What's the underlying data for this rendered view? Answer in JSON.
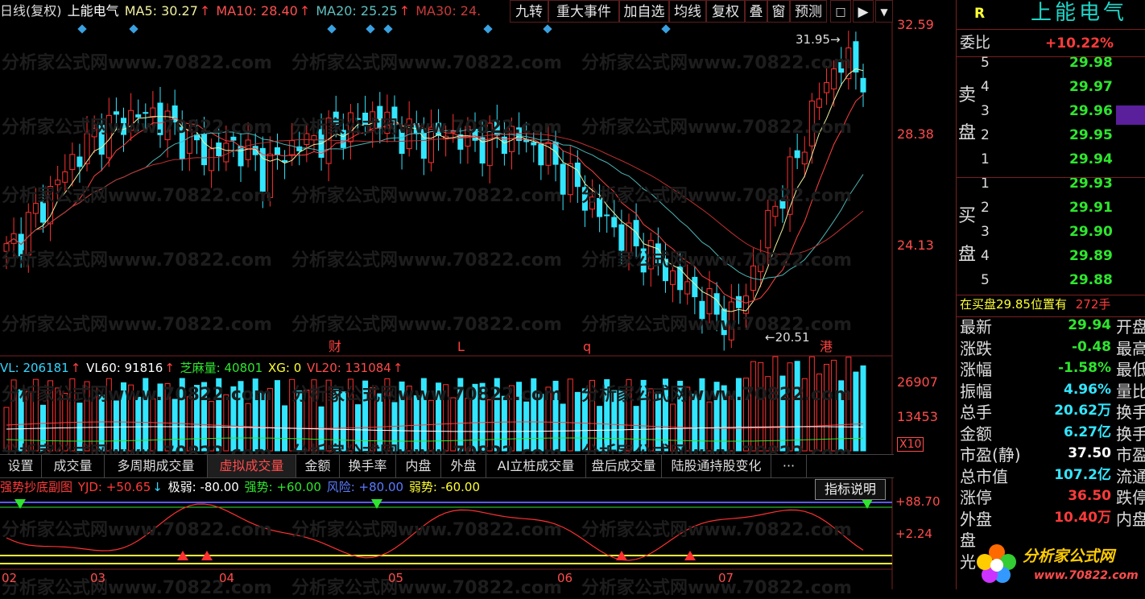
{
  "header": {
    "period": "日线(复权)",
    "stock_name": "上能电气",
    "ma5": "MA5: 30.27",
    "ma10": "MA10: 28.40",
    "ma20": "MA20: 25.25",
    "ma30": "MA30: 24.",
    "arrow": "↑"
  },
  "toolbar": {
    "btn_jiuzhuan": "九转",
    "btn_events": "重大事件",
    "btn_add": "加自选",
    "btn_ma": "均线",
    "btn_fuquan": "复权",
    "btn_die": "叠",
    "btn_chuang": "窗",
    "btn_yuce": "预测",
    "btn_lock": "🔒",
    "btn_jump": "⇥",
    "btn_menu": "▾"
  },
  "price_axis": {
    "top": "32.59",
    "mid": "28.38",
    "low": "24.13"
  },
  "annotations": {
    "high": "31.95",
    "low": "20.51",
    "marker_cai": "财",
    "marker_L": "L",
    "marker_q": "q",
    "marker_gang": "港"
  },
  "volume_legend": {
    "vl": "VL: 206181",
    "vl60": "VL60: 91816",
    "zhima": "芝麻量: 40801",
    "xg": "XG: 0",
    "vl20": "VL20: 131084",
    "arrow": "↑"
  },
  "volume_axis": {
    "top": "26907",
    "mid": "13453",
    "unit": "X10"
  },
  "tabs": [
    "设置",
    "成交量",
    "多周期成交量",
    "虚拟成交量",
    "金额",
    "换手率",
    "内盘",
    "外盘",
    "AI立桩成交量",
    "盘后成交量",
    "陆股通持股变化",
    "···"
  ],
  "active_tab": "虚拟成交量",
  "indicator_legend": {
    "name": "强势抄底副图",
    "yjd": "YJD: +50.65",
    "yjd_arrow": "↓",
    "jiruo": "极弱: -80.00",
    "qiangshi": "强势: +60.00",
    "fengxian": "风险: +80.00",
    "ruoshi": "弱势: -60.00",
    "help_button": "指标说明"
  },
  "indicator_axis": {
    "top": "+88.70",
    "mid": "+2.24"
  },
  "date_axis": [
    "02",
    "03",
    "04",
    "05",
    "06",
    "07"
  ],
  "watermark": "分析家公式网www.70822.com",
  "right_panel": {
    "r_label": "R",
    "title": "上能电气",
    "weibi_label": "委比",
    "weibi_value": "+10.22%",
    "sell_group_label_1": "卖",
    "sell_group_label_2": "盘",
    "buy_group_label_1": "买",
    "buy_group_label_2": "盘",
    "sell": [
      {
        "level": "5",
        "price": "29.98"
      },
      {
        "level": "4",
        "price": "29.97"
      },
      {
        "level": "3",
        "price": "29.96"
      },
      {
        "level": "2",
        "price": "29.95"
      },
      {
        "level": "1",
        "price": "29.94"
      }
    ],
    "buy": [
      {
        "level": "1",
        "price": "29.93"
      },
      {
        "level": "2",
        "price": "29.91"
      },
      {
        "level": "3",
        "price": "29.90"
      },
      {
        "level": "4",
        "price": "29.89"
      },
      {
        "level": "5",
        "price": "29.88"
      }
    ],
    "notice_text": "在买盘29.85位置有",
    "notice_qty": "272手",
    "quotes": [
      {
        "label": "最新",
        "value": "29.94",
        "color": "green",
        "side": "开盘"
      },
      {
        "label": "涨跌",
        "value": "-0.48",
        "color": "green",
        "side": "最高"
      },
      {
        "label": "涨幅",
        "value": "-1.58%",
        "color": "green",
        "side": "最低"
      },
      {
        "label": "振幅",
        "value": "4.96%",
        "color": "cyan",
        "side": "量比"
      },
      {
        "label": "总手",
        "value": "20.62万",
        "color": "cyan",
        "side": "换手"
      },
      {
        "label": "金额",
        "value": "6.27亿",
        "color": "cyan",
        "side": "换手"
      },
      {
        "label": "市盈(静)",
        "value": "37.50",
        "color": "white",
        "side": "市盈"
      },
      {
        "label": "总市值",
        "value": "107.2亿",
        "color": "cyan",
        "side": "流通"
      },
      {
        "label": "涨停",
        "value": "36.50",
        "color": "red",
        "side": "跌停"
      },
      {
        "label": "外盘",
        "value": "10.40万",
        "color": "red",
        "side": "内盘"
      },
      {
        "label": "盘",
        "value": "",
        "color": "white",
        "side": ""
      },
      {
        "label": "光",
        "value": "",
        "color": "white",
        "side": ""
      }
    ],
    "logo_text": "分析家公式网",
    "logo_url": "www.70822.com"
  },
  "colors": {
    "up": "#ff3030",
    "down": "#33e6ff",
    "ma5": "#f0f0a0",
    "ma10": "#ff4040",
    "ma20": "#4db3b3",
    "ma30": "#c03030"
  }
}
